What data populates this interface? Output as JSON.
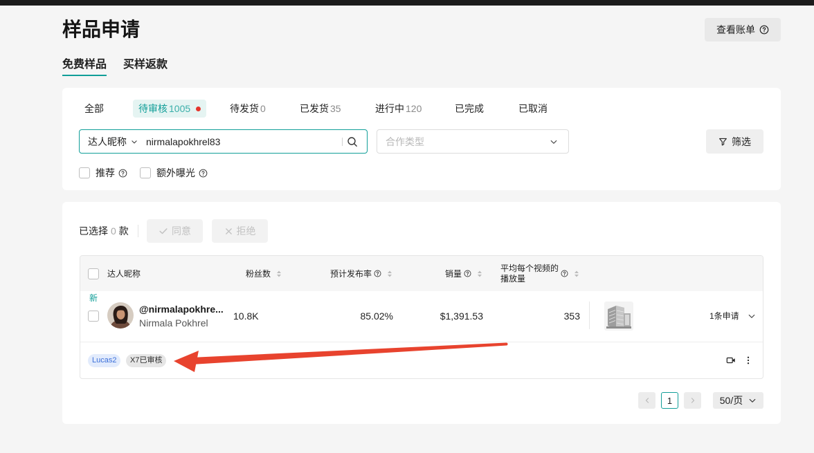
{
  "page": {
    "title": "样品申请",
    "bill_button": {
      "label": "查看账单"
    }
  },
  "main_tabs": [
    {
      "label": "免费样品",
      "active": true
    },
    {
      "label": "买样返款",
      "active": false
    }
  ],
  "status_tabs": [
    {
      "label": "全部",
      "active": false
    },
    {
      "label": "待审核",
      "count": "1005",
      "active": true,
      "has_dot": true
    },
    {
      "label": "待发货",
      "count": "0",
      "active": false
    },
    {
      "label": "已发货",
      "count": "35",
      "active": false
    },
    {
      "label": "进行中",
      "count": "120",
      "active": false
    },
    {
      "label": "已完成",
      "active": false
    },
    {
      "label": "已取消",
      "active": false
    }
  ],
  "search": {
    "field": "达人昵称",
    "value": "nirmalapokhrel83"
  },
  "cooperation_type": {
    "placeholder": "合作类型"
  },
  "filter_button": {
    "label": "筛选"
  },
  "options": [
    {
      "label": "推荐",
      "checked": false
    },
    {
      "label": "额外曝光",
      "checked": false
    }
  ],
  "selection": {
    "prefix": "已选择",
    "count": "0",
    "suffix": "款"
  },
  "bulk_actions": {
    "approve": {
      "label": "同意",
      "disabled": true
    },
    "reject": {
      "label": "拒绝",
      "disabled": true
    }
  },
  "table": {
    "columns": {
      "creator": "达人昵称",
      "followers": "粉丝数",
      "publish_rate": "预计发布率",
      "sales": "销量",
      "avg_views": [
        "平均每个视频的",
        "播放量"
      ]
    },
    "rows": [
      {
        "badge": "新",
        "checked": false,
        "handle": "@nirmalapokhre...",
        "name": "Nirmala Pokhrel",
        "followers": "10.8K",
        "publish_rate": "85.02%",
        "sales": "$1,391.53",
        "avg_views": "353",
        "requests": "1条申请",
        "tags": [
          {
            "label": "Lucas2",
            "bg": "#e2ebfc",
            "fg": "#3b6fd9"
          },
          {
            "label": "X7已审核",
            "bg": "#e6e6e6",
            "fg": "#2a2a2a"
          }
        ]
      }
    ]
  },
  "pagination": {
    "current_page": "1",
    "page_size": "50/页"
  },
  "icons": {
    "help": "question-circle-icon",
    "dropdown": "chevron-down-icon",
    "search": "search-icon",
    "filter": "filter-icon",
    "approve": "check-icon",
    "reject": "close-icon",
    "sort": "sort-icon",
    "video": "video-camera-icon",
    "more": "more-vertical-icon",
    "prev": "chevron-left-icon",
    "next": "chevron-right-icon"
  },
  "colors": {
    "accent": "#109e98",
    "accent_bg": "#e5f4f2",
    "dot": "#e5352c",
    "annotation_arrow": "#e8432e"
  }
}
